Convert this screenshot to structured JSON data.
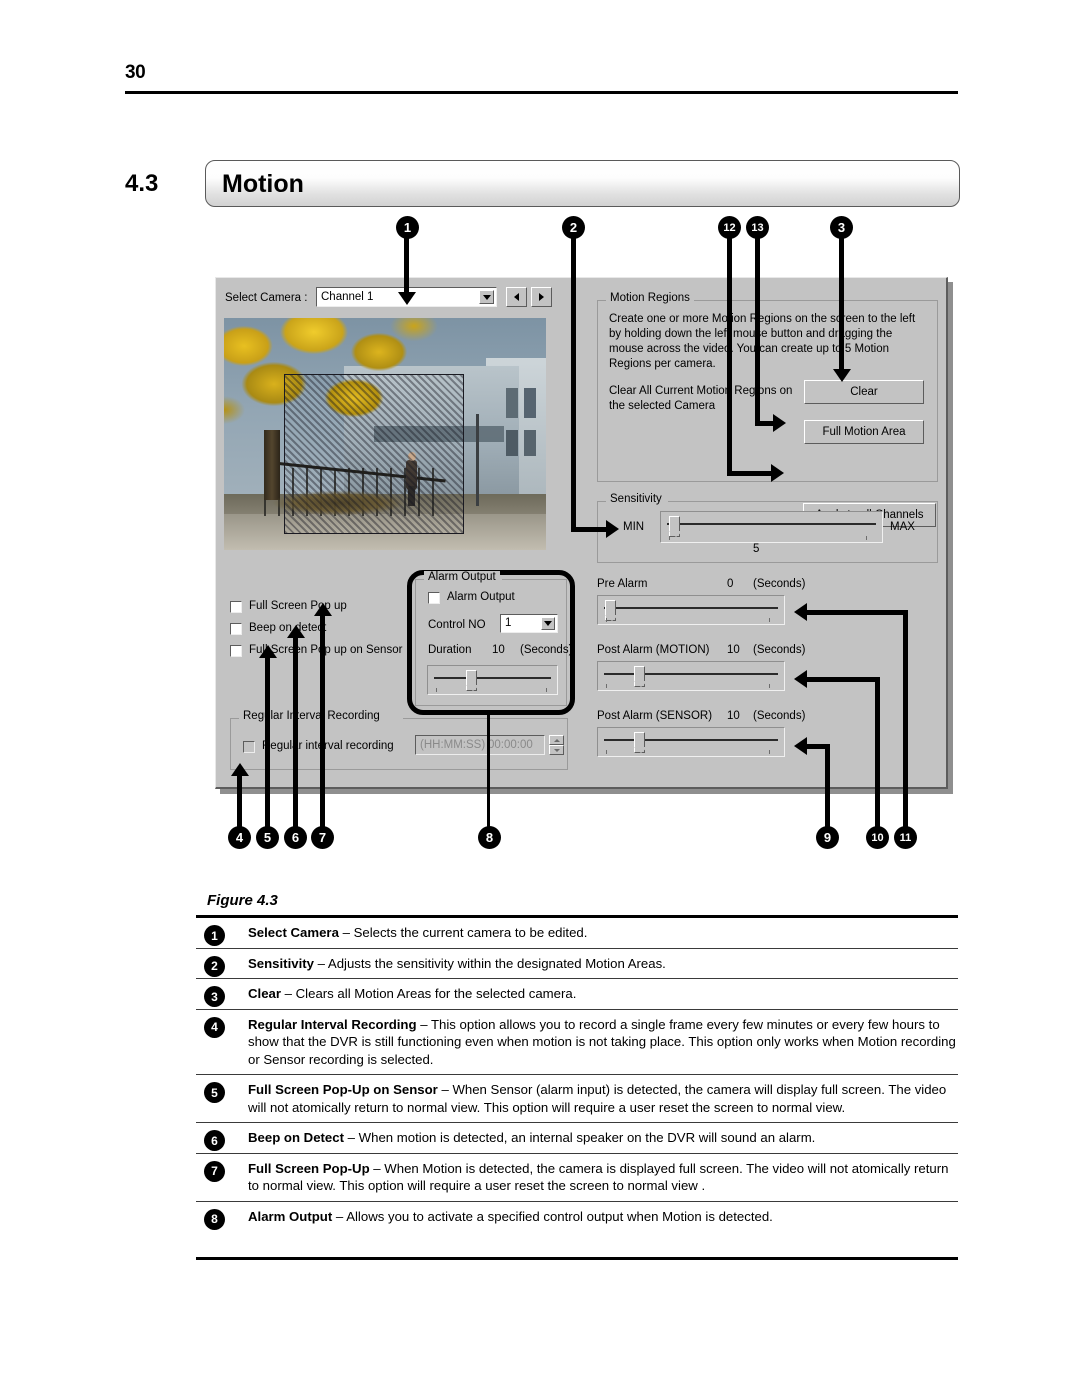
{
  "page": {
    "number": "30"
  },
  "section": {
    "number": "4.3",
    "title": "Motion"
  },
  "dialog": {
    "select_camera_label": "Select Camera :",
    "camera_value": "Channel 1",
    "checkboxes": [
      {
        "label": "Full Screen Pop up"
      },
      {
        "label": "Beep on detect"
      },
      {
        "label": "Full Screen Pop up on Sensor"
      }
    ],
    "regular_interval": {
      "group_title": "Regular Interval Recording",
      "checkbox_label": "Regular interval recording",
      "format_hint": "(HH:MM:SS)",
      "value": "00:00:00"
    },
    "alarm_output": {
      "group_title": "Alarm Output",
      "checkbox_label": "Alarm Output",
      "control_label": "Control NO",
      "control_value": "1",
      "duration_label": "Duration",
      "duration_value": "10",
      "duration_unit": "(Seconds)"
    },
    "motion_regions": {
      "group_title": "Motion Regions",
      "description": "Create one or more Motion Regions on the screen to the left by holding down the left mouse button and dragging the mouse across the video. You can create up to 5 Motion Regions per camera.",
      "clear_description": "Clear All Current Motion Regions on the selected Camera",
      "btn_clear": "Clear",
      "btn_full_motion_area": "Full Motion Area",
      "btn_apply_all": "Apply to all Channels"
    },
    "sensitivity": {
      "group_title": "Sensitivity",
      "min_label": "MIN",
      "max_label": "MAX",
      "value": "5"
    },
    "pre_alarm": {
      "label": "Pre Alarm",
      "value": "0",
      "unit": "(Seconds)"
    },
    "post_alarm_motion": {
      "label": "Post Alarm (MOTION)",
      "value": "10",
      "unit": "(Seconds)"
    },
    "post_alarm_sensor": {
      "label": "Post Alarm (SENSOR)",
      "value": "10",
      "unit": "(Seconds)"
    }
  },
  "callouts": {
    "c1": "1",
    "c2": "2",
    "c3": "3",
    "c4": "4",
    "c5": "5",
    "c6": "6",
    "c7": "7",
    "c8": "8",
    "c9": "9",
    "c10": "10",
    "c11": "11",
    "c12": "12",
    "c13": "13"
  },
  "figure": {
    "caption": "Figure 4.3"
  },
  "legend": [
    {
      "num": "1",
      "term": "Select Camera",
      "text": " – Selects the current camera to be edited."
    },
    {
      "num": "2",
      "term": "Sensitivity",
      "text": " – Adjusts the sensitivity within the designated Motion Areas."
    },
    {
      "num": "3",
      "term": "Clear",
      "text": " – Clears all Motion Areas for the selected camera."
    },
    {
      "num": "4",
      "term": "Regular Interval Recording",
      "text": " – This option allows you to record a single frame every few minutes or every few hours to show that the DVR is still functioning even when motion is not taking place. This option only works when Motion recording or Sensor recording is selected."
    },
    {
      "num": "5",
      "term": "Full Screen Pop-Up on Sensor",
      "text": " – When Sensor (alarm input) is detected, the camera will display full screen. The video will not atomically return to normal view. This option will require a user reset the screen to normal view."
    },
    {
      "num": "6",
      "term": "Beep on Detect",
      "text": " – When motion is detected, an internal speaker on the DVR will sound an alarm."
    },
    {
      "num": "7",
      "term": "Full Screen Pop-Up",
      "text": " – When Motion is detected, the camera is displayed full screen. The video will not atomically return to normal view. This option will require a user reset the screen to normal view  ."
    },
    {
      "num": "8",
      "term": "Alarm Output",
      "text": " – Allows you to activate a specified control output when Motion is detected."
    }
  ]
}
